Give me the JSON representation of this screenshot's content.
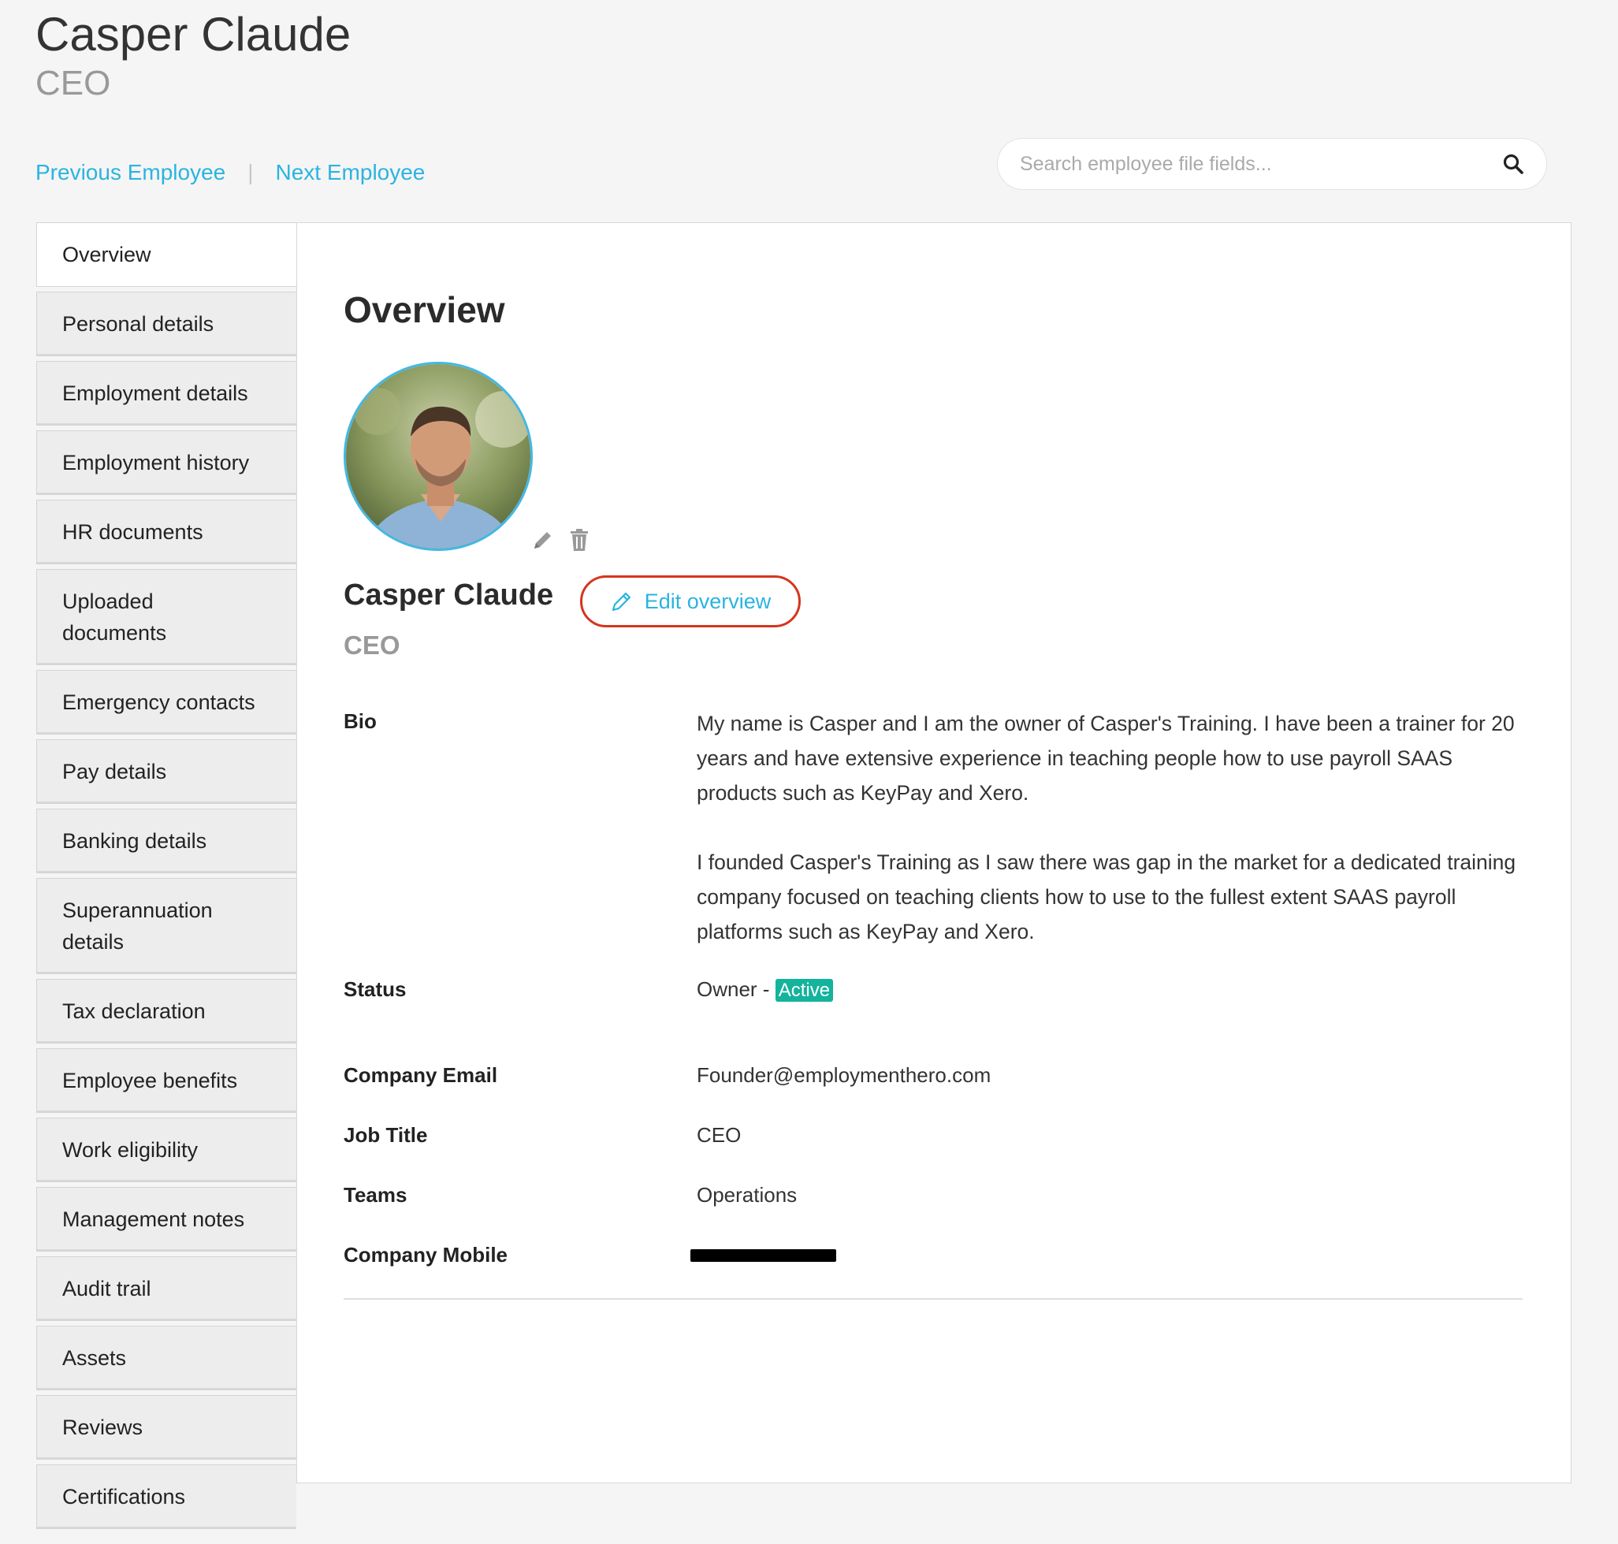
{
  "header": {
    "name": "Casper Claude",
    "title": "CEO"
  },
  "nav": {
    "previous": "Previous Employee",
    "separator": "|",
    "next": "Next Employee"
  },
  "search": {
    "placeholder": "Search employee file fields...",
    "value": ""
  },
  "sidebar": {
    "items": [
      {
        "label": "Overview"
      },
      {
        "label": "Personal details"
      },
      {
        "label": "Employment details"
      },
      {
        "label": "Employment history"
      },
      {
        "label": "HR documents"
      },
      {
        "label": "Uploaded documents"
      },
      {
        "label": "Emergency contacts"
      },
      {
        "label": "Pay details"
      },
      {
        "label": "Banking details"
      },
      {
        "label": "Superannuation details"
      },
      {
        "label": "Tax declaration"
      },
      {
        "label": "Employee benefits"
      },
      {
        "label": "Work eligibility"
      },
      {
        "label": "Management notes"
      },
      {
        "label": "Audit trail"
      },
      {
        "label": "Assets"
      },
      {
        "label": "Reviews"
      },
      {
        "label": "Certifications"
      }
    ]
  },
  "overview": {
    "heading": "Overview",
    "name": "Casper Claude",
    "title": "CEO",
    "edit_label": "Edit overview",
    "fields": {
      "bio": {
        "label": "Bio",
        "paragraphs": [
          "My name is Casper and I am the owner of Casper's Training. I have been a trainer for 20 years and have extensive experience in teaching people how to use payroll SAAS products such as KeyPay and Xero.",
          "I founded Casper's Training as I saw there was gap in the market for a dedicated training company focused on teaching clients how to use to the fullest extent SAAS payroll platforms such as KeyPay and Xero."
        ]
      },
      "status": {
        "label": "Status",
        "value": "Owner - ",
        "badge": "Active"
      },
      "email": {
        "label": "Company Email",
        "value": "Founder@employmenthero.com"
      },
      "job_title": {
        "label": "Job Title",
        "value": "CEO"
      },
      "teams": {
        "label": "Teams",
        "value": "Operations"
      },
      "mobile": {
        "label": "Company Mobile",
        "value": ""
      }
    }
  },
  "colors": {
    "link": "#2ab4e0",
    "badge": "#13b39c",
    "edit_border": "#d5351f",
    "avatar_ring": "#43b8e2"
  },
  "icons": {
    "search": "search-icon",
    "edit_photo": "pencil-icon",
    "delete_photo": "trash-icon",
    "edit_overview": "pencil-outline-icon"
  }
}
